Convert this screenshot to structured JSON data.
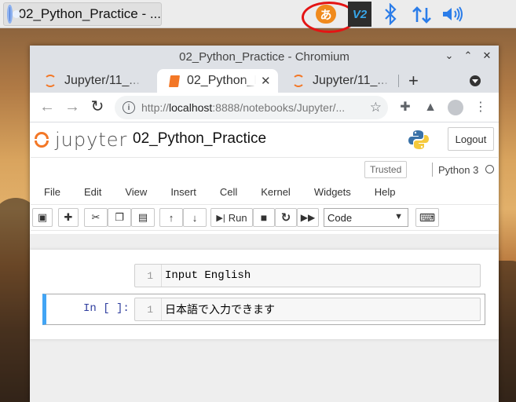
{
  "taskbar": {
    "app_title": "02_Python_Practice - ...",
    "ime_glyph": "あ",
    "vnc_glyph": "V2",
    "accent": "#f08a1c"
  },
  "window": {
    "title": "02_Python_Practice - Chromium",
    "controls": [
      "⌄",
      "⌃",
      "✕"
    ]
  },
  "tabs": [
    {
      "label": "Jupyter/11_...",
      "icon": "jupyter-icon"
    },
    {
      "label": "02_Python_P...",
      "icon": "notebook-icon",
      "active": true
    },
    {
      "label": "Jupyter/11_...",
      "icon": "jupyter-icon"
    }
  ],
  "toolbar": {
    "url_scheme": "http://",
    "url_host": "localhost",
    "url_rest": ":8888/notebooks/Jupyter/...",
    "new_tab": "+",
    "close_glyph": "✕"
  },
  "jupyter": {
    "logo_text": "jupyter",
    "notebook_name": "02_Python_Practice",
    "logout_label": "Logout",
    "trusted_label": "Trusted",
    "kernel_name": "Python 3",
    "menu": [
      "File",
      "Edit",
      "View",
      "Insert",
      "Cell",
      "Kernel",
      "Widgets",
      "Help"
    ],
    "run_label": "Run",
    "cell_type": "Code",
    "cells": [
      {
        "prompt": "",
        "line_no": "1",
        "code": "Input English"
      },
      {
        "prompt": "In [ ]:",
        "line_no": "1",
        "code": "日本語で入力できます"
      }
    ]
  }
}
